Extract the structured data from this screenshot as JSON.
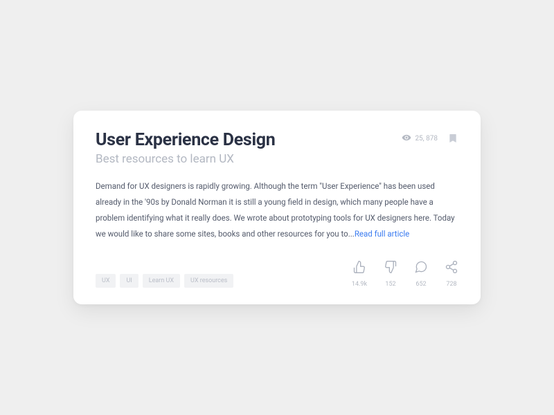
{
  "card": {
    "title": "User Experience Design",
    "subtitle": "Best resources to learn UX",
    "views": "25, 878",
    "body": "Demand for UX designers is rapidly growing. Although the term \"User Experience\" has been used already in the '90s by Donald Norman it is still a young field in design, which many people have a problem identifying what it really does. We wrote about prototyping tools for UX designers here. Today we would like to share some sites, books and other resources for you to...",
    "read_more": "Read full article",
    "tags": [
      "UX",
      "UI",
      "Learn UX",
      "UX resources"
    ],
    "actions": {
      "like": "14.9k",
      "dislike": "152",
      "comment": "652",
      "share": "728"
    }
  }
}
